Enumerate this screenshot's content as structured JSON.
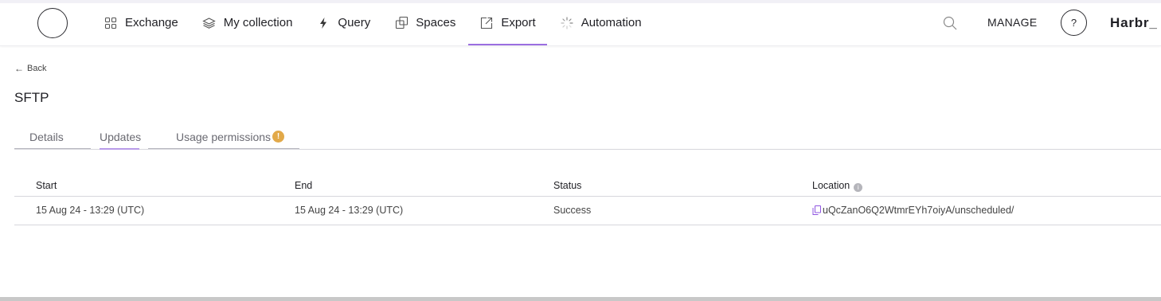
{
  "nav": {
    "items": [
      {
        "label": "Exchange",
        "icon": "grid-icon"
      },
      {
        "label": "My collection",
        "icon": "layers-icon"
      },
      {
        "label": "Query",
        "icon": "lightning-icon"
      },
      {
        "label": "Spaces",
        "icon": "spaces-icon"
      },
      {
        "label": "Export",
        "icon": "export-icon",
        "active": true
      },
      {
        "label": "Automation",
        "icon": "spinner-icon"
      }
    ],
    "active_color": "#9b6ee0"
  },
  "header": {
    "manage_label": "MANAGE",
    "help_label": "?",
    "brand": "Harbr_"
  },
  "page": {
    "back_label": "Back",
    "title": "SFTP"
  },
  "tabs": [
    {
      "label": "Details"
    },
    {
      "label": "Updates",
      "active": true
    },
    {
      "label": "Usage permissions",
      "badge": "!"
    }
  ],
  "table": {
    "columns": [
      "Start",
      "End",
      "Status",
      "Location"
    ],
    "rows": [
      {
        "start": "15 Aug 24 - 13:29 (UTC)",
        "end": "15 Aug 24 - 13:29 (UTC)",
        "status": "Success",
        "location": "uQcZanO6Q2WtmrEYh7oiyA/unscheduled/"
      }
    ]
  },
  "colors": {
    "link": "#8f55e0",
    "badge": "#e2a949"
  }
}
